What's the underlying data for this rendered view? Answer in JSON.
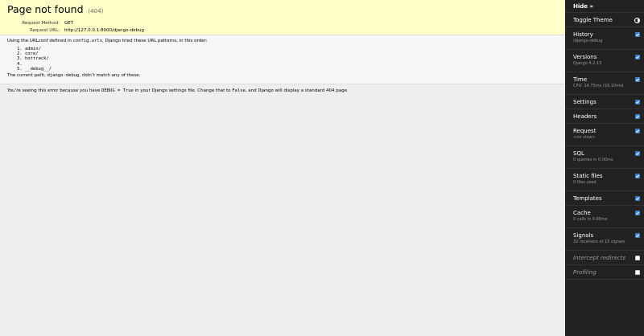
{
  "error": {
    "title": "Page not found",
    "code": "(404)",
    "request_method_label": "Request Method:",
    "request_method": "GET",
    "request_url_label": "Request URL:",
    "request_url": "http://127.0.0.1:8000/django-debug"
  },
  "info": {
    "intro_before": "Using the URLconf defined in ",
    "urlconf": "config.urls",
    "intro_after": ", Django tried these URL patterns, in this order:",
    "patterns": [
      "admin/",
      "core/",
      "hottrack/",
      "",
      "__debug__/"
    ],
    "current_before": "The current path, ",
    "current_path": "django-debug",
    "current_after": ", didn’t match any of these."
  },
  "explanation": {
    "part1": "You’re seeing this error because you have ",
    "code1": "DEBUG = True",
    "part2": " in your Django settings file. Change that to ",
    "code2": "False",
    "part3": ", and Django will display a standard 404 page."
  },
  "toolbar": {
    "hide_label": "Hide »",
    "toggle_theme": "Toggle Theme",
    "panels": [
      {
        "title": "History",
        "sub": "/django-debug",
        "checked": true,
        "enabled": true
      },
      {
        "title": "Versions",
        "sub": "Django 4.2.13",
        "checked": true,
        "enabled": true
      },
      {
        "title": "Time",
        "sub": "CPU: 14.75ms (16.10ms)",
        "checked": true,
        "enabled": true
      },
      {
        "title": "Settings",
        "sub": "",
        "checked": true,
        "enabled": true
      },
      {
        "title": "Headers",
        "sub": "",
        "checked": true,
        "enabled": true
      },
      {
        "title": "Request",
        "sub": "<no view>",
        "checked": true,
        "enabled": true
      },
      {
        "title": "SQL",
        "sub": "0 queries in 0.00ms",
        "checked": true,
        "enabled": true
      },
      {
        "title": "Static files",
        "sub": "0 files used",
        "checked": true,
        "enabled": true
      },
      {
        "title": "Templates",
        "sub": "",
        "checked": true,
        "enabled": true
      },
      {
        "title": "Cache",
        "sub": "0 calls in 0.00ms",
        "checked": true,
        "enabled": true
      },
      {
        "title": "Signals",
        "sub": "32 receivers of 15 signals",
        "checked": true,
        "enabled": true
      },
      {
        "title": "Intercept redirects",
        "sub": "",
        "checked": false,
        "enabled": false
      },
      {
        "title": "Profiling",
        "sub": "",
        "checked": false,
        "enabled": false
      }
    ]
  }
}
